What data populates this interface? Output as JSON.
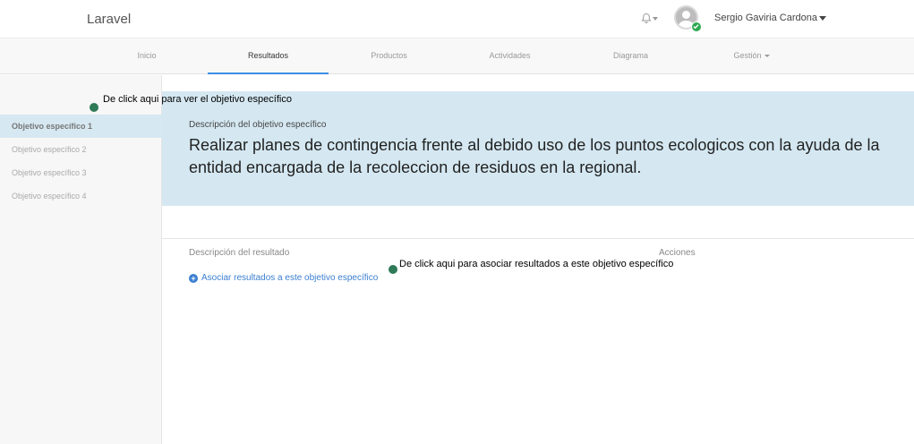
{
  "navbar": {
    "brand": "Laravel",
    "user_name": "Sergio Gaviria Cardona"
  },
  "tabs": [
    {
      "label": "Inicio"
    },
    {
      "label": "Resultados"
    },
    {
      "label": "Productos"
    },
    {
      "label": "Actividades"
    },
    {
      "label": "Diagrama"
    },
    {
      "label": "Gestión"
    }
  ],
  "sidebar": {
    "items": [
      {
        "label": "Objetivo específico 1"
      },
      {
        "label": "Objetivo específico 2"
      },
      {
        "label": "Objetivo específico 3"
      },
      {
        "label": "Objetivo específico 4"
      }
    ]
  },
  "objective": {
    "label": "Descripción del objetivo específico",
    "text": "Realizar planes de contingencia frente al debido uso de los puntos ecologicos con la ayuda de la entidad encargada de la recoleccion de residuos en la regional."
  },
  "results": {
    "col_description": "Descripción del resultado",
    "col_actions": "Acciones",
    "associate_link": "Asociar resultados a este objetivo específico"
  },
  "annotations": {
    "note1": "De click aqui para ver el objetivo específico",
    "note2": "De click aqui para asociar resultados a este objetivo específico"
  },
  "colors": {
    "accent": "#3b7fd0",
    "panel": "#d5e8f2",
    "annotation_dot": "#2f7a57",
    "badge": "#2eaa52"
  },
  "icons": {
    "bell": "bell-icon",
    "plus": "plus-circle-icon",
    "avatar": "user-avatar"
  }
}
